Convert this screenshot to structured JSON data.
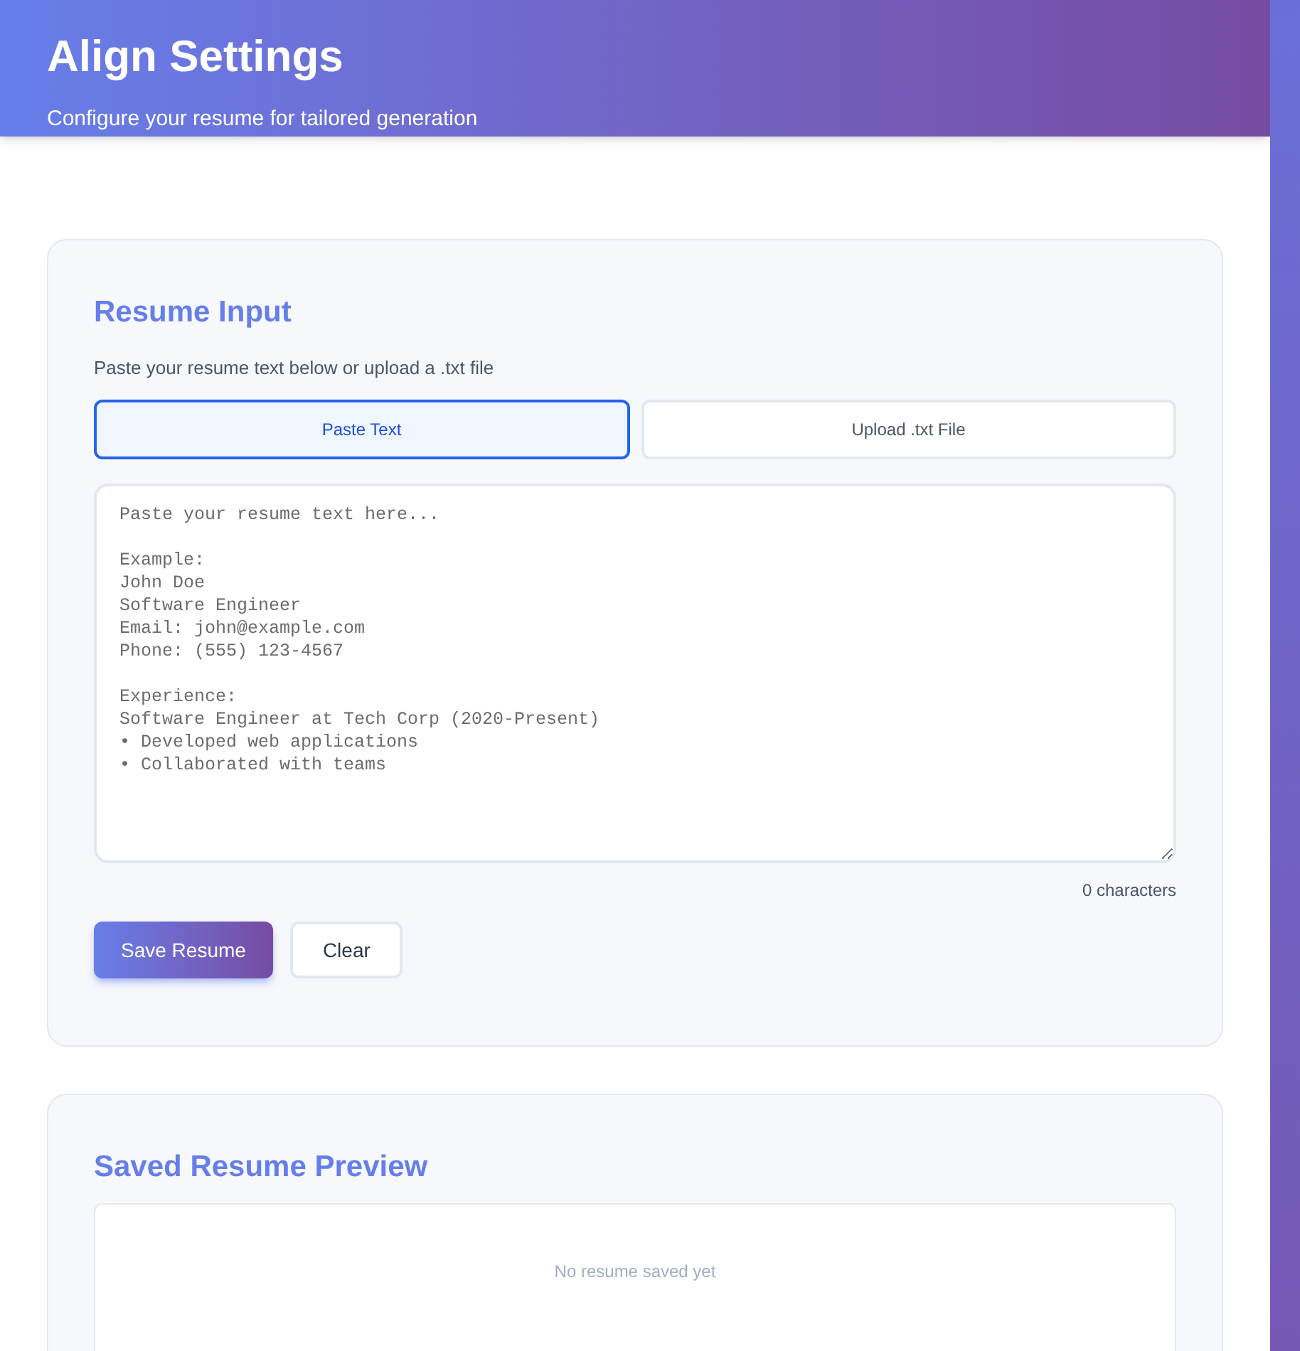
{
  "header": {
    "title": "Align Settings",
    "subtitle": "Configure your resume for tailored generation"
  },
  "resume_input": {
    "title": "Resume Input",
    "description": "Paste your resume text below or upload a .txt file",
    "tabs": [
      {
        "label": "Paste Text",
        "selected": true
      },
      {
        "label": "Upload .txt File",
        "selected": false
      }
    ],
    "textarea": {
      "placeholder": "Paste your resume text here...\n\nExample:\nJohn Doe\nSoftware Engineer\nEmail: john@example.com\nPhone: (555) 123-4567\n\nExperience:\nSoftware Engineer at Tech Corp (2020-Present)\n• Developed web applications\n• Collaborated with teams"
    },
    "char_count": "0 characters",
    "buttons": [
      {
        "label": "Save Resume",
        "kind": "primary"
      },
      {
        "label": "Clear",
        "kind": "secondary"
      }
    ]
  },
  "preview": {
    "title": "Saved Resume Preview",
    "empty_text": "No resume saved yet"
  }
}
